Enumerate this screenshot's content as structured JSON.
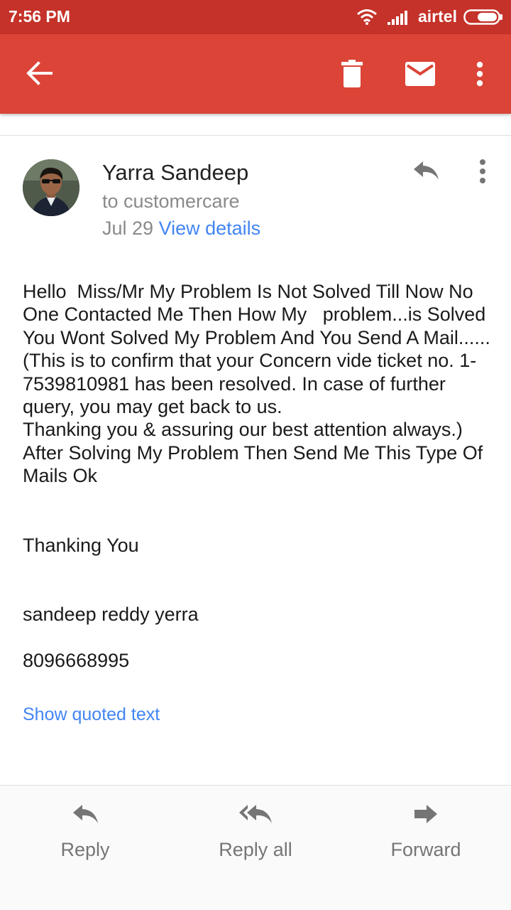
{
  "status_bar": {
    "time": "7:56 PM",
    "carrier": "airtel",
    "icons": [
      "wifi-icon",
      "signal-icon",
      "battery-icon"
    ]
  },
  "toolbar": {
    "back_icon": "arrow-back-icon",
    "delete_icon": "trash-icon",
    "mark_unread_icon": "mail-icon",
    "more_icon": "more-vert-icon"
  },
  "message": {
    "sender": "Yarra Sandeep",
    "recipient": "to customercare",
    "date": "Jul 29",
    "view_details": "View details",
    "reply_icon": "reply-icon",
    "more_icon": "more-vert-icon",
    "body": {
      "paragraph1": "Hello  Miss/Mr My Problem Is Not Solved Till Now No One Contacted Me Then How My   problem...is Solved You Wont Solved My Problem And You Send A Mail...... (This is to confirm that your Concern vide ticket no. 1-7539810981 has been resolved. In case of further query, you may get back to us.",
      "paragraph2": "Thanking you & assuring our best attention always.)",
      "paragraph3": "After Solving My Problem Then Send Me This Type Of Mails Ok",
      "closing": "Thanking You",
      "signature_name": "sandeep reddy yerra",
      "signature_phone": "8096668995"
    },
    "show_quoted": "Show quoted text"
  },
  "actions": {
    "reply": "Reply",
    "reply_all": "Reply all",
    "forward": "Forward"
  },
  "colors": {
    "status_bar": "#c53229",
    "app_bar": "#db4437",
    "link": "#4285f4"
  }
}
